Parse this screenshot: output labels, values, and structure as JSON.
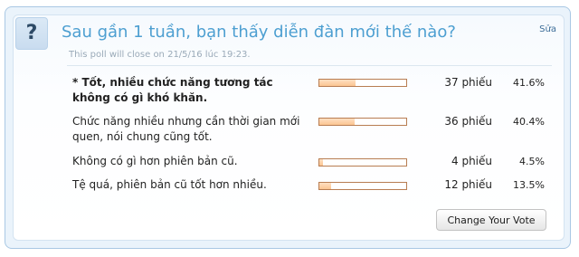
{
  "poll": {
    "icon_glyph": "?",
    "icon_name": "question-icon",
    "question": "Sau gần 1 tuần, bạn thấy diễn đàn mới thế nào?",
    "edit_label": "Sửa",
    "close_note": "This poll will close on 21/5/16 lúc 19:23.",
    "voted_marker": "* ",
    "options": [
      {
        "text": "Tốt, nhiều chức năng tương tác không có gì khó khăn.",
        "voted": true,
        "votes": "37 phiếu",
        "percent": "41.6%",
        "fraction": 0.416
      },
      {
        "text": "Chức năng nhiều nhưng cần thời gian mới quen, nói chung cũng tốt.",
        "voted": false,
        "votes": "36 phiếu",
        "percent": "40.4%",
        "fraction": 0.404
      },
      {
        "text": "Không có gì hơn phiên bản cũ.",
        "voted": false,
        "votes": "4 phiếu",
        "percent": "4.5%",
        "fraction": 0.045
      },
      {
        "text": "Tệ quá, phiên bản cũ tốt hơn nhiều.",
        "voted": false,
        "votes": "12 phiếu",
        "percent": "13.5%",
        "fraction": 0.135
      }
    ],
    "change_vote_label": "Change Your Vote"
  },
  "colors": {
    "title": "#4d9fd1",
    "bar_border": "#b87d52",
    "bar_fill": "#fbc592",
    "frame_border": "#a9c8e4"
  }
}
